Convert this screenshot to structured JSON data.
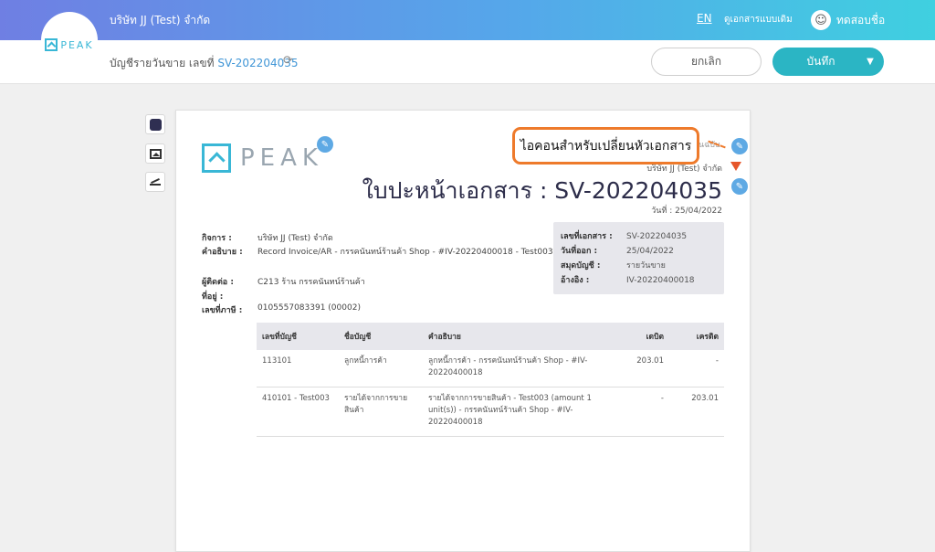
{
  "topbar": {
    "company": "บริษัท JJ (Test) จำกัด",
    "logo_text": "PEAK",
    "lang": "EN",
    "view_old": "ดูเอกสารแบบเดิม",
    "username": "ทดสอบชื่อ"
  },
  "subbar": {
    "crumb_label": "บัญชีรายวันขาย เลขที่",
    "doc_no": "SV-202204035",
    "cancel_label": "ยกเลิก",
    "save_label": "บันทึก"
  },
  "icons": {
    "refresh": "refresh-icon",
    "pencil": "pencil-icon",
    "caret": "chevron-down-icon"
  },
  "paper": {
    "logo_text": "PEAK",
    "callout": "ไอคอนสำหรับเปลี่ยนหัวเอกสาร",
    "behind_text": "้นฉบับ",
    "company": "บริษัท JJ (Test) จำกัด",
    "title": "ใบปะหน้าเอกสาร : SV-202204035",
    "date": "วันที่ : 25/04/2022",
    "info": {
      "business_label": "กิจการ :",
      "business_value": "บริษัท JJ (Test) จำกัด",
      "desc_label": "คำอธิบาย :",
      "desc_value": "Record Invoice/AR - กรรคนันทน์ร้านค้า Shop - #IV-20220400018 - Test003",
      "contact_label": "ผู้ติดต่อ :",
      "contact_value": "C213 ร้าน กรรคนันทน์ร้านค้า",
      "address_label": "ที่อยู่ :",
      "tax_label": "เลขที่ภาษี :",
      "tax_value": "0105557083391 (00002)"
    },
    "meta": [
      {
        "k": "เลขที่เอกสาร :",
        "v": "SV-202204035"
      },
      {
        "k": "วันที่ออก :",
        "v": "25/04/2022"
      },
      {
        "k": "สมุดบัญชี :",
        "v": "รายวันขาย"
      },
      {
        "k": "อ้างอิง :",
        "v": "IV-20220400018"
      }
    ],
    "table": {
      "headers": [
        "เลขที่บัญชี",
        "ชื่อบัญชี",
        "คำอธิบาย",
        "เดบิต",
        "เครดิต"
      ],
      "rows": [
        {
          "account": "113101",
          "name": "ลูกหนี้การค้า",
          "desc": "ลูกหนี้การค้า - กรรคนันทน์ร้านค้า Shop - #IV-20220400018",
          "debit": "203.01",
          "credit": "-"
        },
        {
          "account": "410101 - Test003",
          "name": "รายได้จากการขายสินค้า",
          "desc": "รายได้จากการขายสินค้า - Test003 (amount 1 unit(s)) - กรรคนันทน์ร้านค้า Shop - #IV-20220400018",
          "debit": "-",
          "credit": "203.01"
        }
      ]
    }
  }
}
